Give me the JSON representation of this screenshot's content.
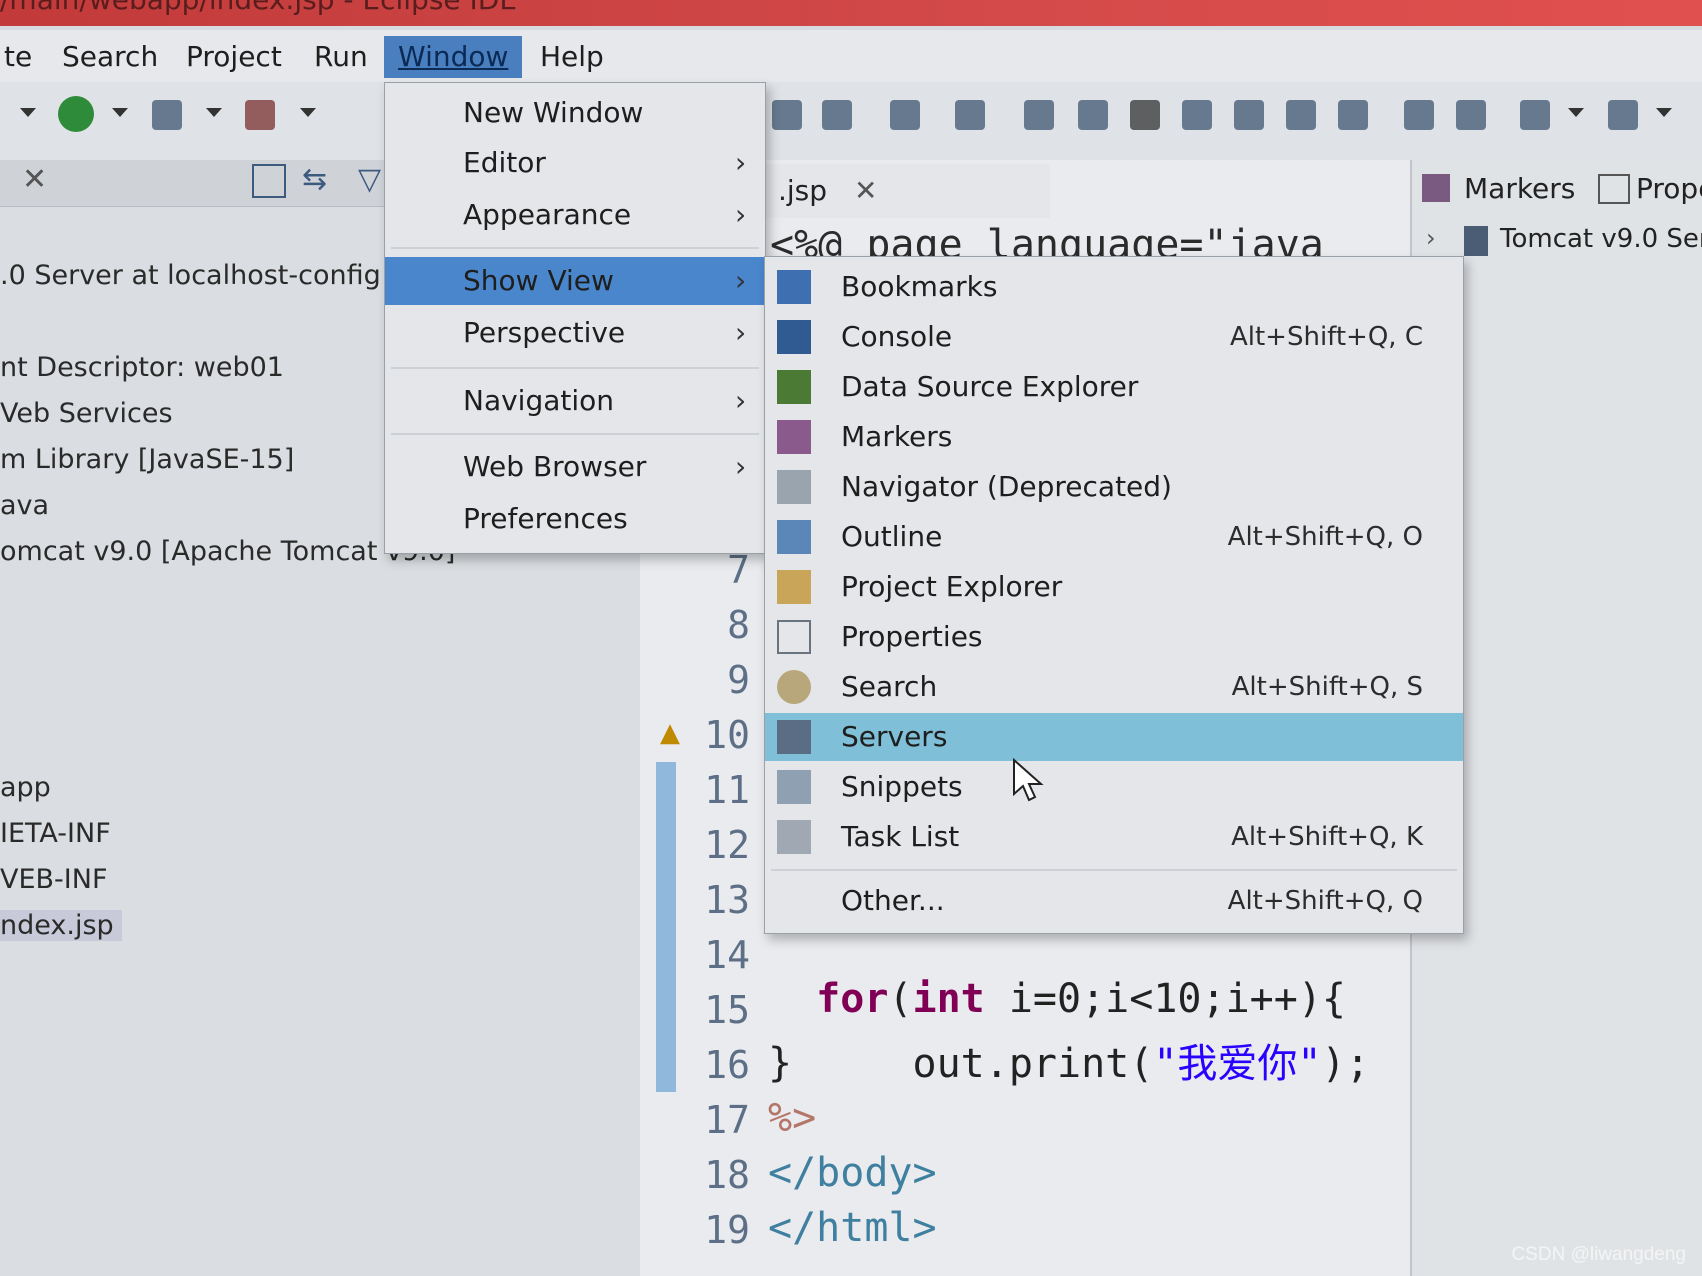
{
  "window": {
    "title": "/main/webapp/index.jsp - Eclipse IDE"
  },
  "menubar": {
    "items": [
      {
        "label": "te"
      },
      {
        "label": "Search"
      },
      {
        "label": "Project"
      },
      {
        "label": "Run"
      },
      {
        "label": "Window"
      },
      {
        "label": "Help"
      }
    ],
    "active": "Window"
  },
  "explorer": {
    "items": [
      {
        "label": ".0 Server at localhost-config"
      },
      {
        "label": "nt Descriptor: web01"
      },
      {
        "label": "Veb Services"
      },
      {
        "label": "m Library [JavaSE-15]"
      },
      {
        "label": "ava"
      },
      {
        "label": "omcat v9.0 [Apache Tomcat v9.0]"
      },
      {
        "label": "app"
      },
      {
        "label": "IETA-INF"
      },
      {
        "label": "VEB-INF"
      },
      {
        "label": "ndex.jsp"
      }
    ]
  },
  "editor": {
    "tab_label": ".jsp",
    "header_code": "<%@ page language=\"java",
    "lines": [
      {
        "num": "7",
        "code": ""
      },
      {
        "num": "8",
        "code": ""
      },
      {
        "num": "9",
        "code": ""
      },
      {
        "num": "10",
        "code": ""
      },
      {
        "num": "11",
        "code": ""
      },
      {
        "num": "12",
        "code": ""
      },
      {
        "num": "13",
        "code": ""
      },
      {
        "num": "14",
        "code_kw1": "for",
        "code_rest1": "(",
        "code_kw2": "int",
        "code_rest2": " i=0;i<10;i++){"
      },
      {
        "num": "15",
        "code_pre": "    out.print(",
        "code_str": "\"我爱你\"",
        "code_post": ");"
      },
      {
        "num": "16",
        "code": "}"
      },
      {
        "num": "17",
        "code": "%>"
      },
      {
        "num": "18",
        "code": "</body>"
      },
      {
        "num": "19",
        "code": "</html>"
      }
    ]
  },
  "rightpane": {
    "tab_markers": "Markers",
    "tab_props": "Prope",
    "server_entry": "Tomcat v9.0 Ser"
  },
  "window_menu": {
    "items": [
      {
        "label": "New Window",
        "submenu": false
      },
      {
        "label": "Editor",
        "submenu": true
      },
      {
        "label": "Appearance",
        "submenu": true
      },
      {
        "label": "Show View",
        "submenu": true,
        "highlighted": true
      },
      {
        "label": "Perspective",
        "submenu": true
      },
      {
        "label": "Navigation",
        "submenu": true
      },
      {
        "label": "Web Browser",
        "submenu": true
      },
      {
        "label": "Preferences",
        "submenu": false
      }
    ]
  },
  "show_view_menu": {
    "items": [
      {
        "label": "Bookmarks",
        "shortcut": "",
        "icon": "bookmarks-icon"
      },
      {
        "label": "Console",
        "shortcut": "Alt+Shift+Q, C",
        "icon": "console-icon"
      },
      {
        "label": "Data Source Explorer",
        "shortcut": "",
        "icon": "data-source-icon"
      },
      {
        "label": "Markers",
        "shortcut": "",
        "icon": "markers-icon"
      },
      {
        "label": "Navigator (Deprecated)",
        "shortcut": "",
        "icon": "navigator-icon"
      },
      {
        "label": "Outline",
        "shortcut": "Alt+Shift+Q, O",
        "icon": "outline-icon"
      },
      {
        "label": "Project Explorer",
        "shortcut": "",
        "icon": "project-explorer-icon"
      },
      {
        "label": "Properties",
        "shortcut": "",
        "icon": "properties-icon"
      },
      {
        "label": "Search",
        "shortcut": "Alt+Shift+Q, S",
        "icon": "search-icon"
      },
      {
        "label": "Servers",
        "shortcut": "",
        "icon": "servers-icon",
        "highlighted": true
      },
      {
        "label": "Snippets",
        "shortcut": "",
        "icon": "snippets-icon"
      },
      {
        "label": "Task List",
        "shortcut": "Alt+Shift+Q, K",
        "icon": "task-list-icon"
      },
      {
        "label": "Other...",
        "shortcut": "Alt+Shift+Q, Q",
        "icon": ""
      }
    ]
  },
  "watermark": "CSDN @liwangdeng",
  "colors": {
    "menu_highlight": "#4a86cc",
    "submenu_highlight": "#80bfd8",
    "keyword": "#7f0055",
    "string": "#2a00ff"
  }
}
